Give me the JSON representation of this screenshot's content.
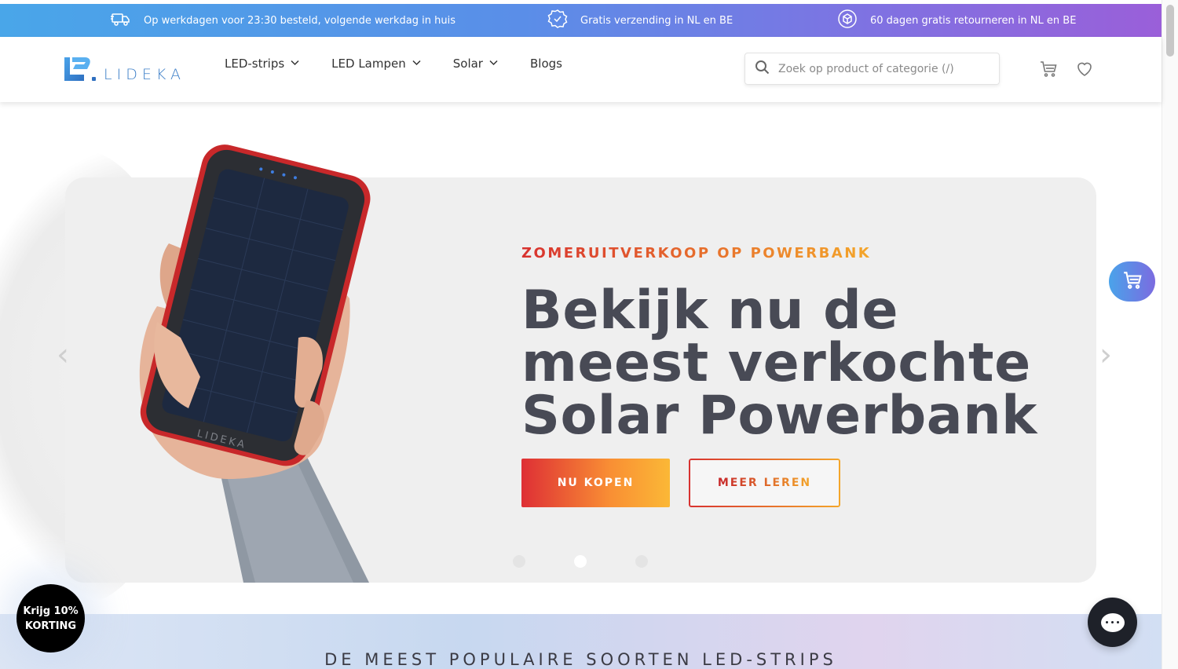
{
  "promo_bar": {
    "items": [
      {
        "icon": "delivery-truck-icon",
        "text": "Op werkdagen voor 23:30 besteld, volgende werkdag in huis"
      },
      {
        "icon": "check-badge-icon",
        "text": "Gratis verzending in NL en BE"
      },
      {
        "icon": "return-box-icon",
        "text": "60 dagen gratis retourneren in NL en BE"
      }
    ]
  },
  "header": {
    "logo_text": "LIDEKA",
    "nav": [
      {
        "label": "LED-strips",
        "has_dropdown": true
      },
      {
        "label": "LED Lampen",
        "has_dropdown": true
      },
      {
        "label": "Solar",
        "has_dropdown": true
      },
      {
        "label": "Blogs",
        "has_dropdown": false
      }
    ],
    "search_placeholder": "Zoek op product of categorie (/)",
    "icons": [
      "cart-icon",
      "heart-icon"
    ]
  },
  "hero": {
    "eyebrow": "ZOMERUITVERKOOP OP POWERBANK",
    "title_line1": "Bekijk nu de",
    "title_line2": "meest verkochte",
    "title_line3": "Solar Powerbank",
    "primary_button": "NU KOPEN",
    "secondary_button": "MEER LEREN",
    "slide_count": 3,
    "active_slide": 2,
    "prev_arrow": "‹",
    "next_arrow": "›",
    "product_image_text": "LIDEKA"
  },
  "popular": {
    "title": "DE MEEST POPULAIRE SOORTEN LED-STRIPS"
  },
  "discount_badge": {
    "line1": "Krijg 10%",
    "line2": "KORTING"
  },
  "colors": {
    "promo_gradient_start": "#49a6e9",
    "promo_gradient_end": "#9a5fd9",
    "accent_red": "#de2f35",
    "accent_orange": "#fbb836",
    "title_color": "#484a55",
    "brand_blue": "#3d7fc8"
  }
}
